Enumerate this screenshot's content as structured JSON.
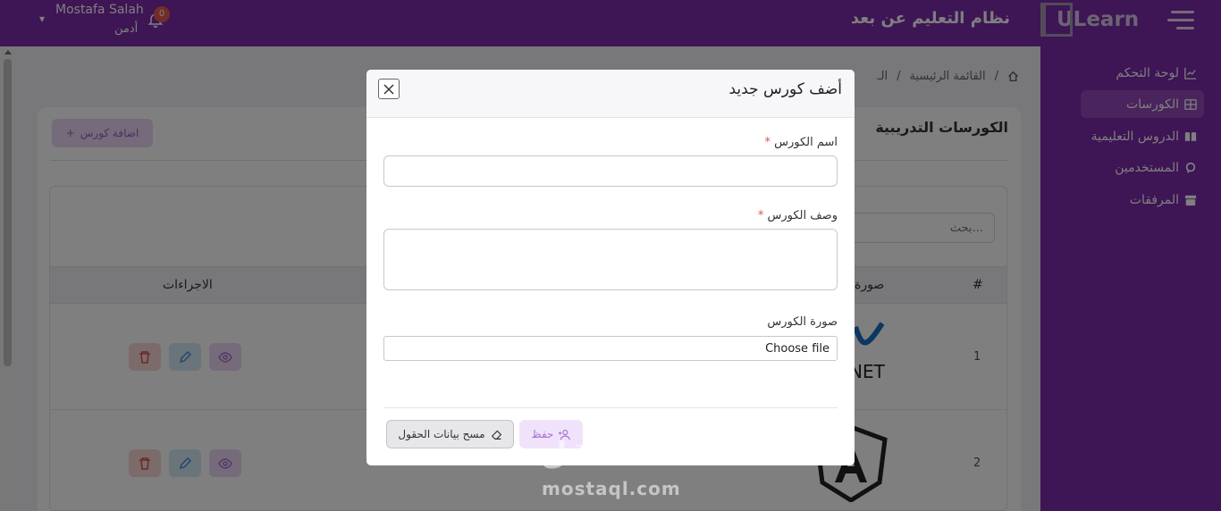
{
  "header": {
    "app_title": "نظام التعليم عن بعد",
    "logo_text": "ULearn",
    "user_name": "Mostafa Salah",
    "user_role": "أدمن",
    "notification_count": "0"
  },
  "sidebar": {
    "items": [
      {
        "label": "لوحة التحكم",
        "icon": "chart-icon",
        "active": false
      },
      {
        "label": "الكورسات",
        "icon": "grid-icon",
        "active": true
      },
      {
        "label": "الدروس التعليمية",
        "icon": "book-icon",
        "active": false
      },
      {
        "label": "المستخدمين",
        "icon": "user-icon",
        "active": false
      },
      {
        "label": "المرفقات",
        "icon": "archive-icon",
        "active": false
      }
    ]
  },
  "breadcrumb": {
    "home_icon": "home-icon",
    "items": [
      "القائمة الرئيسية",
      "الـ"
    ]
  },
  "page": {
    "title": "الكورسات التدريبية",
    "add_button": "اضافة كورس",
    "search_placeholder": "بحث..."
  },
  "table": {
    "headers": {
      "index": "#",
      "image": "صورة",
      "actions": "الاجراءات"
    },
    "rows": [
      {
        "index": "1",
        "image_text": "NET"
      },
      {
        "index": "2",
        "image_text": ""
      }
    ]
  },
  "modal": {
    "title": "أضف كورس جديد",
    "name_label": "اسم الكورس",
    "name_value": "",
    "description_label": "وصف الكورس",
    "description_value": "",
    "image_label": "صورة الكورس",
    "file_button": "Choose file",
    "clear_button": "مسح بيانات الحقول",
    "save_button": "حفظ"
  },
  "watermark": {
    "arabic": "مستقل",
    "latin": "mostaql.com"
  },
  "colors": {
    "brand": "#7c2aaa",
    "active_nav": "#9349bb",
    "required": "#d9534f"
  }
}
